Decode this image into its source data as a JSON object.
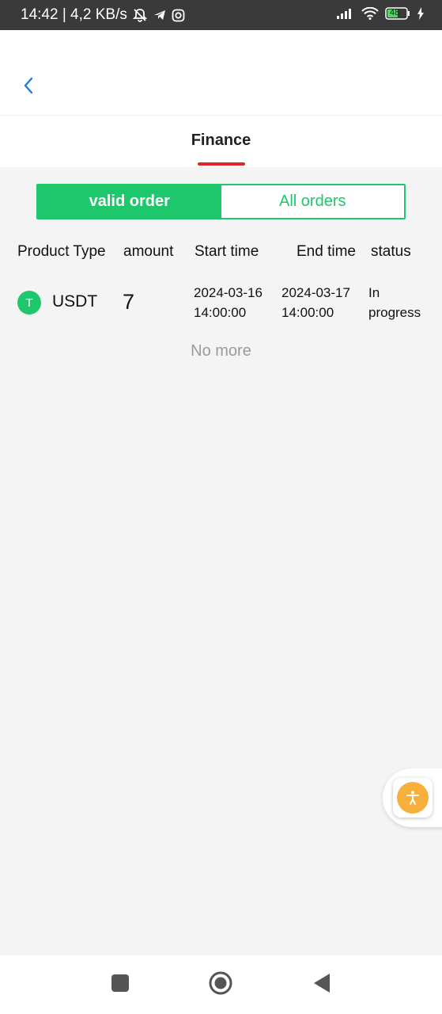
{
  "status_bar": {
    "time_speed": "14:42 | 4,2 KB/s",
    "battery": "48",
    "icons": [
      "mute-bell-icon",
      "telegram-icon",
      "instagram-icon",
      "signal-icon",
      "wifi-icon",
      "battery-icon",
      "charging-icon"
    ]
  },
  "header": {
    "back_icon": "chevron-left-icon",
    "tab_title": "Finance",
    "accent_color": "#e0252f"
  },
  "segment": {
    "active_label": "valid order",
    "inactive_label": "All orders",
    "color": "#1ec76b"
  },
  "table": {
    "headers": [
      "Product Type",
      "amount",
      "Start time",
      "End time",
      "status"
    ],
    "rows": [
      {
        "icon_letter": "T",
        "product": "USDT",
        "amount": "7",
        "start_date": "2024-03-16",
        "start_clock": "14:00:00",
        "end_date": "2024-03-17",
        "end_clock": "14:00:00",
        "status_line1": "In",
        "status_line2": "progress"
      }
    ]
  },
  "footer_text": "No more",
  "floating_button": {
    "icon": "accessibility-icon",
    "color": "#f7b03c"
  },
  "nav": {
    "icons": [
      "recent-apps-icon",
      "home-icon",
      "back-triangle-icon"
    ]
  }
}
